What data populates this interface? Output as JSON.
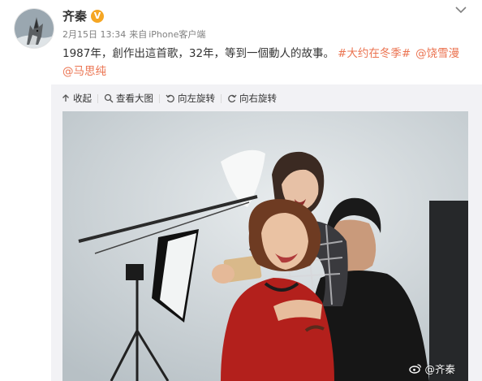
{
  "post": {
    "author": "齐秦",
    "verified_mark": "V",
    "date": "2月15日 13:34",
    "from_label": "来自",
    "device": "iPhone客户端",
    "text": "1987年，創作出這首歌，32年，等到一個動人的故事。",
    "hashtag": "#大约在冬季#",
    "mentions": [
      "@饶雪漫",
      "@马思纯"
    ]
  },
  "toolbar": {
    "collapse_label": "收起",
    "view_large_label": "查看大图",
    "rotate_left_label": "向左旋转",
    "rotate_right_label": "向右旋转"
  },
  "photo": {
    "watermark_text": "@齐秦"
  },
  "colors": {
    "accent_link": "#eb7350",
    "verified_badge": "#f5a623",
    "meta_gray": "#808080",
    "panel_bg": "#f2f2f5"
  },
  "icons": {
    "menu": "chevron-down-icon",
    "collapse": "arrow-up-icon",
    "view_large": "magnifier-icon",
    "rotate_left": "rotate-left-icon",
    "rotate_right": "rotate-right-icon",
    "watermark": "weibo-logo-icon"
  }
}
